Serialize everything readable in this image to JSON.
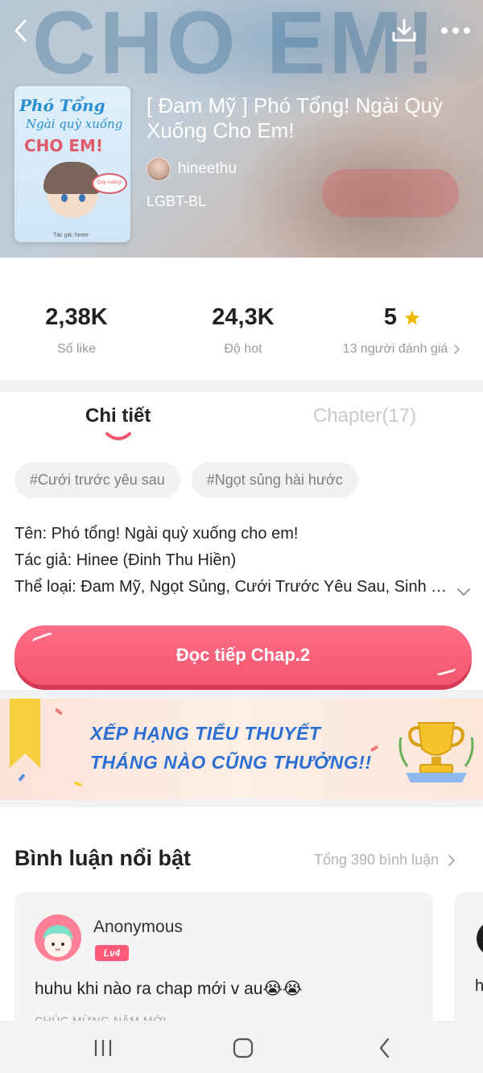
{
  "header": {
    "bg_word": "CHO EM!",
    "title": "[ Đam Mỹ ] Phó Tổng! Ngài Quỳ Xuống Cho Em!",
    "author": "hineethu",
    "genre": "LGBT-BL",
    "icons": [
      "back-icon",
      "download-icon",
      "more-icon"
    ]
  },
  "cover": {
    "line1": "Phó Tổng",
    "line2": "Ngài quỳ xuống",
    "line3": "CHO EM!",
    "bubble": "Quỳ xuống!",
    "author": "Tác giả: hinee"
  },
  "stats": [
    {
      "value": "2,38K",
      "label": "Số like"
    },
    {
      "value": "24,3K",
      "label": "Độ hot"
    },
    {
      "value": "5",
      "label": "13 người đánh giá"
    }
  ],
  "tabs": {
    "detail": "Chi tiết",
    "chapter": "Chapter(17)"
  },
  "tags": [
    "#Cưới trước yêu sau",
    "#Ngọt sủng hài hước"
  ],
  "info": {
    "name": "Tên: Phó tổng! Ngài quỳ xuống cho em!",
    "author": "Tác giả: Hinee (Đinh Thu Hiền)",
    "genres": "Thể loại: Đam Mỹ, Ngọt Sủng, Cưới Trước Yêu Sau, Sinh Tử..."
  },
  "cta": {
    "label": "Đọc tiếp Chap.2"
  },
  "banner": {
    "line1": "XẾP HẠNG TIỂU THUYẾT",
    "line2": "THÁNG NÀO CŨNG THƯỞNG!!"
  },
  "comments": {
    "title": "Bình luận nổi bật",
    "total": "Tổng 390 bình luận",
    "items": [
      {
        "user": "Anonymous",
        "level": "Lv4",
        "text": "huhu khi nào ra chap mới v au😭😭",
        "sub": "CHÚC MỪNG NĂM MỚI"
      },
      {
        "text": "h"
      }
    ]
  },
  "colors": {
    "accent": "#f2566f",
    "star": "#f5b800",
    "banner_text": "#2c6fd2"
  }
}
